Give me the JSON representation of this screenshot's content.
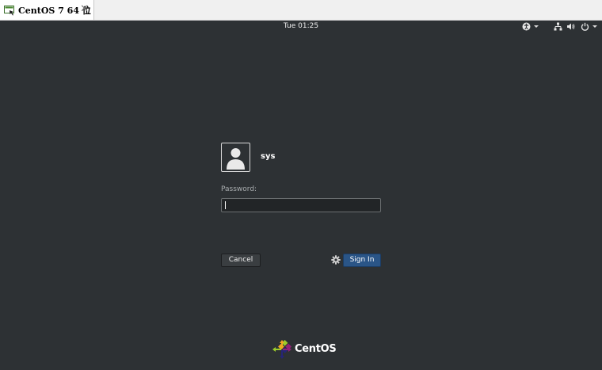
{
  "vm_tab": {
    "title": "CentOS 7 64 位",
    "close_glyph": "✕",
    "icon": "vm-window-icon"
  },
  "topbar": {
    "clock": "Tue 01:25",
    "tray_icons": [
      "accessibility-icon",
      "network-icon",
      "volume-icon",
      "power-icon"
    ]
  },
  "login": {
    "username": "sys",
    "password_label": "Password:",
    "password_value": "",
    "cancel_label": "Cancel",
    "signin_label": "Sign In",
    "session_icon": "gear-icon"
  },
  "branding": {
    "text": "CentOS"
  },
  "colors": {
    "background": "#2d3134",
    "signin": "#2a5587",
    "text": "#ffffff"
  }
}
